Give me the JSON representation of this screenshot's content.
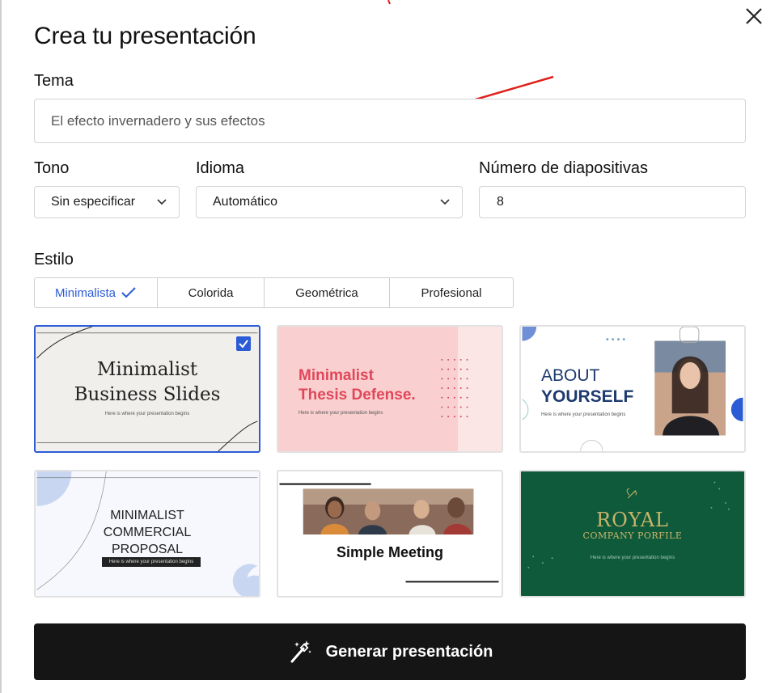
{
  "dialog": {
    "title": "Crea tu presentación"
  },
  "tema": {
    "label": "Tema",
    "value": "El efecto invernadero y sus efectos"
  },
  "tono": {
    "label": "Tono",
    "value": "Sin especificar"
  },
  "idioma": {
    "label": "Idioma",
    "value": "Automático"
  },
  "diapositivas": {
    "label": "Número de diapositivas",
    "value": "8"
  },
  "estilo": {
    "label": "Estilo",
    "tabs": [
      {
        "label": "Minimalista",
        "active": true
      },
      {
        "label": "Colorida",
        "active": false
      },
      {
        "label": "Geométrica",
        "active": false
      },
      {
        "label": "Profesional",
        "active": false
      }
    ]
  },
  "templates": [
    {
      "title_line1": "Minimalist",
      "title_line2": "Business Slides",
      "subtitle": "Here is where your presentation begins",
      "selected": true,
      "bg": "#f1efec"
    },
    {
      "title_line1": "Minimalist",
      "title_line2": "Thesis Defense.",
      "subtitle": "Here is where your presentation begins",
      "selected": false,
      "bg": "#f9d0cf",
      "accent": "#e0475b"
    },
    {
      "title_line1": "ABOUT",
      "title_line2": "YOURSELF",
      "subtitle": "Here is where your presentation begins",
      "selected": false,
      "bg": "#ffffff",
      "accent": "#1d3a6e"
    },
    {
      "title_line1": "MINIMALIST",
      "title_line2": "COMMERCIAL",
      "title_line3": "PROPOSAL",
      "subtitle": "Here is where your presentation begins",
      "selected": false,
      "bg": "#f6f8fd"
    },
    {
      "title_line1": "Simple Meeting",
      "selected": false,
      "bg": "#ffffff"
    },
    {
      "title_line1": "ROYAL",
      "title_line2": "COMPANY PORFILE",
      "subtitle": "Here is where your presentation begins",
      "selected": false,
      "bg": "#0e5a3a",
      "accent": "#c9b46a"
    }
  ],
  "generate": {
    "label": "Generar presentación"
  },
  "colors": {
    "accent_blue": "#2c5bd6",
    "annotation_red": "#e0201b",
    "button_dark": "#151515"
  }
}
